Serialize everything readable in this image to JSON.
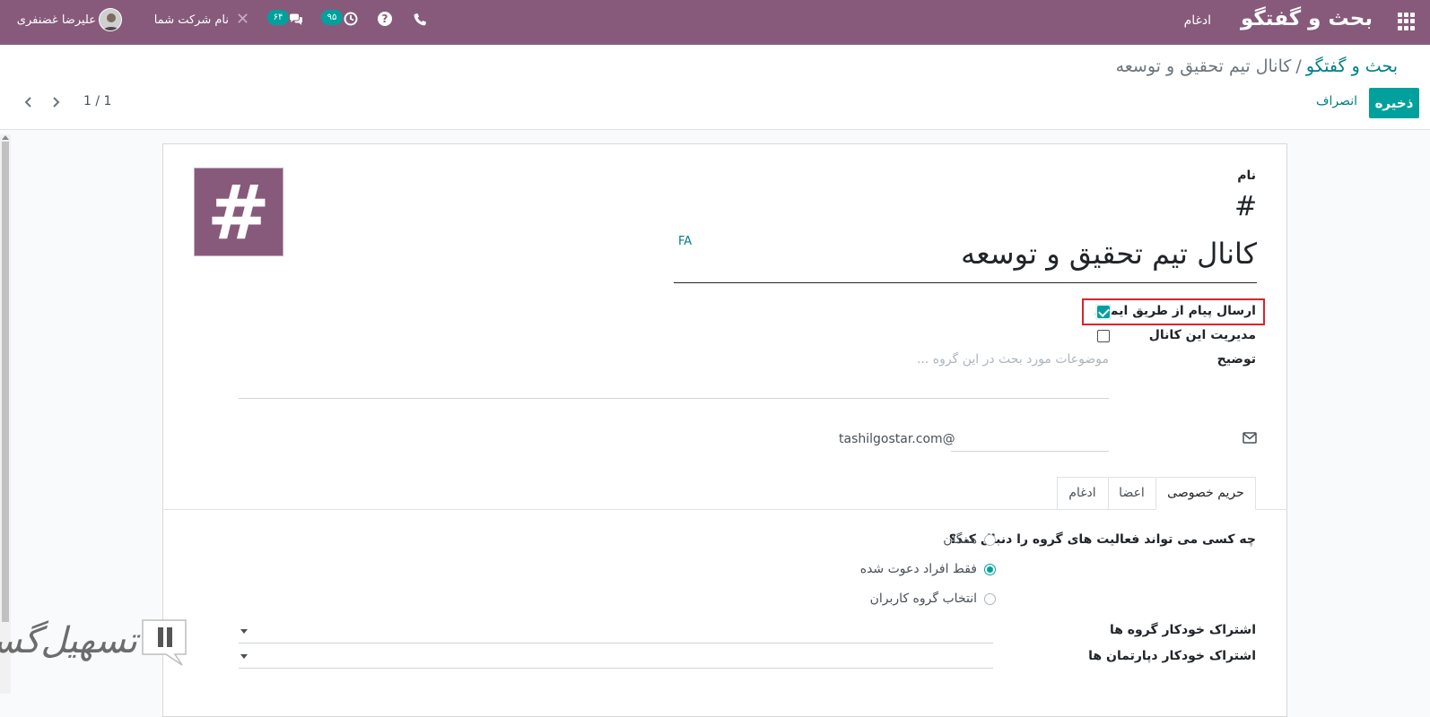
{
  "navbar": {
    "app_title": "بحث و گفتگو",
    "menu_merge": "ادغام",
    "company_name": "نام شرکت شما",
    "user_name": "علیرضا غضنفری",
    "activity_count": "۹۵",
    "message_count": "۶۴",
    "help_glyph": "?",
    "debug_glyph": "✕",
    "accent": "#875a7b",
    "badge_color": "#00a09d",
    "icons": [
      "apps-icon",
      "phone-icon",
      "help-icon",
      "clock-icon",
      "chat-icon",
      "debug-icon",
      "avatar"
    ]
  },
  "control_panel": {
    "breadcrumb_parent": "بحث و گفتگو",
    "breadcrumb_separator": "/",
    "breadcrumb_current": "کانال تیم تحقیق و توسعه",
    "save_label": "ذخیره",
    "discard_label": "انصراف",
    "pager_value": "1 / 1",
    "primary_color": "#00a09d",
    "link_color": "#017e84"
  },
  "form": {
    "image_glyph": "#",
    "name_label": "نام",
    "name_prefix": "#",
    "name_value": "کانال تیم تحقیق و توسعه",
    "language_code": "FA",
    "email_send_label": "ارسال پیام از طریق ایمیل",
    "email_send_checked": true,
    "manage_channel_label": "مدیریت این کانال",
    "manage_channel_checked": false,
    "description_label": "توضیح",
    "description_placeholder": "موضوعات مورد بحث در این گروه ...",
    "alias_domain": "tashilgostar.com@",
    "alias_value": "",
    "highlight_color": "#d9232d"
  },
  "tabs": {
    "privacy": "حریم خصوصی",
    "members": "اعضا",
    "merge": "ادغام",
    "active": "privacy"
  },
  "privacy": {
    "question": "چه کسی می تواند فعالیت های گروه را دنبال کند؟",
    "options": [
      {
        "label": "همگان",
        "checked": false
      },
      {
        "label": "فقط افراد دعوت شده",
        "checked": true
      },
      {
        "label": "انتخاب گروه کاربران",
        "checked": false
      }
    ],
    "auto_subscribe_groups_label": "اشتراک خودکار گروه ها",
    "auto_subscribe_departments_label": "اشتراک خودکار دپارتمان ها"
  },
  "watermark": {
    "logo_icon": "tashilgostar-logo-icon",
    "text": "تسهیل‌گستر"
  }
}
